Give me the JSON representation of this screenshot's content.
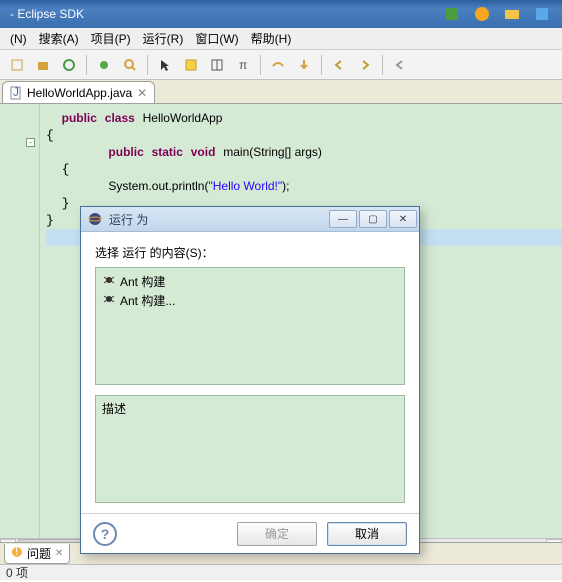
{
  "window": {
    "title": "- Eclipse SDK"
  },
  "menu": {
    "items": [
      "(N)",
      "搜索(A)",
      "项目(P)",
      "运行(R)",
      "窗口(W)",
      "帮助(H)"
    ]
  },
  "editor": {
    "tab_label": "HelloWorldApp.java",
    "code": {
      "line1_kw1": "public",
      "line1_kw2": "class",
      "line1_cls": "HelloWorldApp",
      "line3_kw1": "public",
      "line3_kw2": "static",
      "line3_kw3": "void",
      "line3_fn": "main(String[] args)",
      "line5_call": "System.out.println(",
      "line5_str": "\"Hello World!\"",
      "line5_end": ");"
    }
  },
  "dialog": {
    "title": "运行 为",
    "select_label": "选择 运行 的内容(S)：",
    "list_items": [
      "Ant 构建",
      "Ant 构建..."
    ],
    "desc_label": "描述",
    "ok_label": "确定",
    "cancel_label": "取消"
  },
  "bottom": {
    "tab_label": "问题",
    "status": "0 项"
  }
}
